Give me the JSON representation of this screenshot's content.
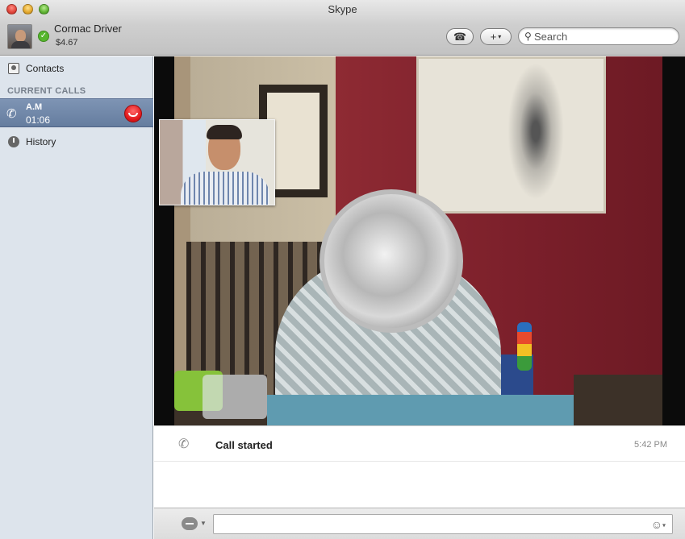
{
  "window": {
    "title": "Skype"
  },
  "profile": {
    "name": "Cormac Driver",
    "credit": "$4.67",
    "status_icon": "check-icon"
  },
  "toolbar": {
    "call_icon": "phone-icon",
    "add_label": "+",
    "add_caret": "▾",
    "search_placeholder": "Search"
  },
  "sidebar": {
    "contacts_label": "Contacts",
    "section_header": "CURRENT CALLS",
    "current_call": {
      "name": "A.M",
      "duration": "01:06"
    },
    "history_label": "History"
  },
  "chat": {
    "event_text": "Call started",
    "event_time": "5:42 PM"
  },
  "colors": {
    "accent_call_row": "#6f87aa",
    "hangup_red": "#e0161a",
    "status_green": "#56b62e"
  }
}
